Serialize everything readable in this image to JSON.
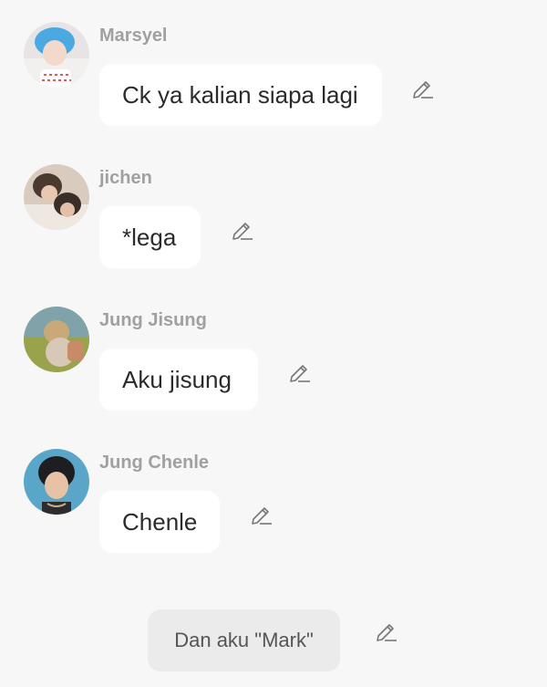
{
  "messages": [
    {
      "sender": "Marsyel",
      "text": "Ck ya kalian siapa lagi",
      "avatar": "avatar-marsyel",
      "edit_icon": "pencil-icon"
    },
    {
      "sender": "jichen",
      "text": "*lega",
      "avatar": "avatar-jichen",
      "edit_icon": "pencil-icon"
    },
    {
      "sender": "Jung Jisung",
      "text": "Aku jisung",
      "avatar": "avatar-jung-jisung",
      "edit_icon": "pencil-icon"
    },
    {
      "sender": "Jung Chenle",
      "text": "Chenle",
      "avatar": "avatar-jung-chenle",
      "edit_icon": "pencil-icon"
    }
  ],
  "system_message": {
    "text": "Dan aku \"Mark\"",
    "edit_icon": "pencil-icon"
  },
  "colors": {
    "background": "#f7f7f7",
    "bubble": "#ffffff",
    "system_bubble": "#ebebeb",
    "sender_name": "#a0a0a0",
    "message_text": "#2b2b2b",
    "icon": "#777777"
  }
}
